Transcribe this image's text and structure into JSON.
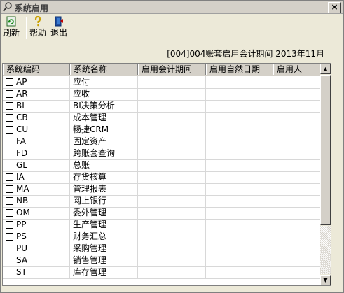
{
  "window": {
    "title": "系统启用"
  },
  "toolbar": {
    "refresh_label": "刷新",
    "help_label": "帮助",
    "exit_label": "退出"
  },
  "period_info": "[004]004账套启用会计期间 2013年11月",
  "table": {
    "columns": [
      "系统编码",
      "系统名称",
      "启用会计期间",
      "启用自然日期",
      "启用人"
    ],
    "rows": [
      {
        "code": "AP",
        "name": "应付"
      },
      {
        "code": "AR",
        "name": "应收"
      },
      {
        "code": "BI",
        "name": "BI决策分析"
      },
      {
        "code": "CB",
        "name": "成本管理"
      },
      {
        "code": "CU",
        "name": "畅捷CRM"
      },
      {
        "code": "FA",
        "name": "固定资产"
      },
      {
        "code": "FD",
        "name": "跨账套查询"
      },
      {
        "code": "GL",
        "name": "总账"
      },
      {
        "code": "IA",
        "name": "存货核算"
      },
      {
        "code": "MA",
        "name": "管理报表"
      },
      {
        "code": "NB",
        "name": "网上银行"
      },
      {
        "code": "OM",
        "name": "委外管理"
      },
      {
        "code": "PP",
        "name": "生产管理"
      },
      {
        "code": "PS",
        "name": "财务汇总"
      },
      {
        "code": "PU",
        "name": "采购管理"
      },
      {
        "code": "SA",
        "name": "销售管理"
      },
      {
        "code": "ST",
        "name": "库存管理"
      }
    ]
  },
  "icons": {
    "title": "search-icon",
    "refresh": "refresh-icon",
    "help": "help-icon",
    "exit": "exit-icon"
  }
}
